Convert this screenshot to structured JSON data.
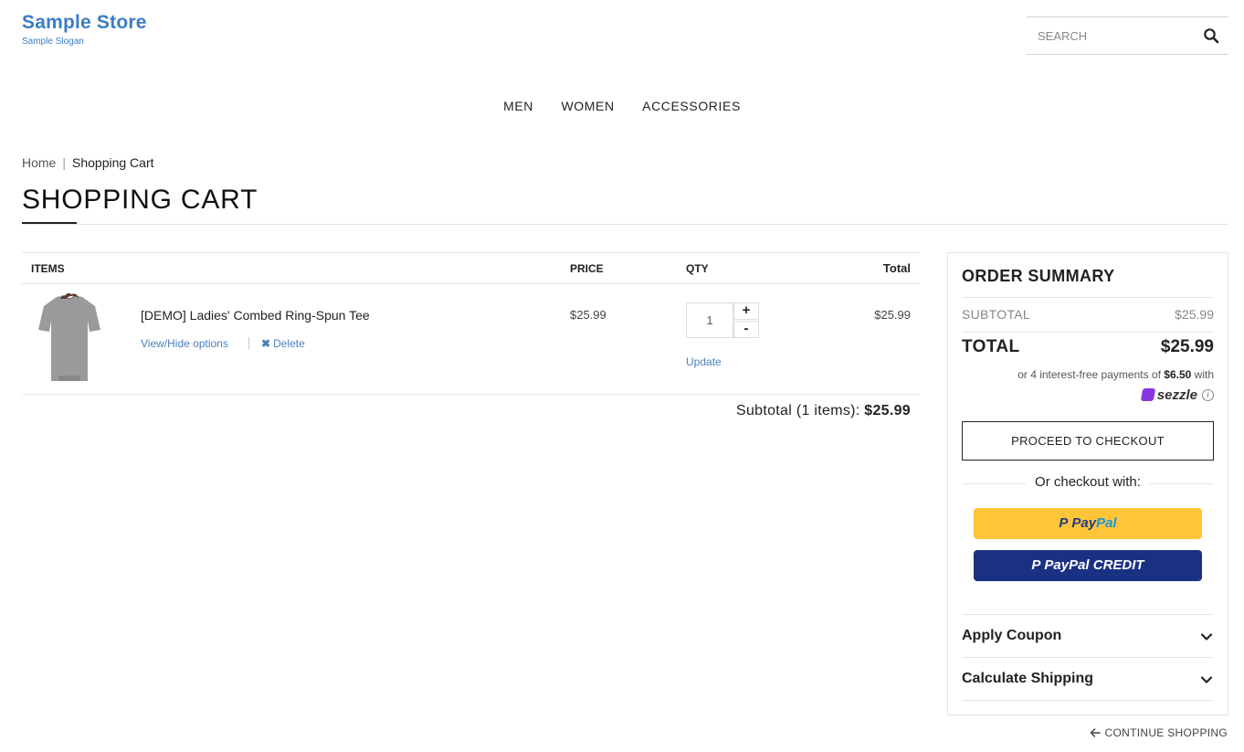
{
  "store": {
    "name": "Sample Store",
    "slogan": "Sample Slogan"
  },
  "search": {
    "placeholder": "SEARCH"
  },
  "nav": [
    "MEN",
    "WOMEN",
    "ACCESSORIES"
  ],
  "breadcrumb": {
    "home": "Home",
    "separator": "|",
    "current": "Shopping Cart"
  },
  "page_title": "SHOPPING CART",
  "cart": {
    "headers": {
      "items": "ITEMS",
      "price": "PRICE",
      "qty": "QTY",
      "total": "Total"
    },
    "items": [
      {
        "name": "[DEMO] Ladies' Combed Ring-Spun Tee",
        "options_link": "View/Hide options",
        "delete_link": "Delete",
        "price": "$25.99",
        "qty": "1",
        "plus": "+",
        "minus": "-",
        "update": "Update",
        "total": "$25.99"
      }
    ],
    "subtotal_label": "Subtotal (1 items):",
    "subtotal_value": "$25.99"
  },
  "summary": {
    "title": "ORDER SUMMARY",
    "subtotal_label": "SUBTOTAL",
    "subtotal_value": "$25.99",
    "total_label": "TOTAL",
    "total_value": "$25.99",
    "sezzle_prefix": "or 4 interest-free payments of",
    "sezzle_amount": "$6.50",
    "sezzle_suffix": "with",
    "sezzle_brand": "sezzle",
    "sezzle_info": "i",
    "checkout_label": "PROCEED TO CHECKOUT",
    "or_checkout": "Or checkout with:",
    "paypal_pay": "Pay",
    "paypal_pal": "Pal",
    "paypal_credit": "PayPal CREDIT",
    "apply_coupon": "Apply Coupon",
    "calculate_shipping": "Calculate Shipping"
  },
  "continue_shopping": "CONTINUE SHOPPING",
  "colors": {
    "accent": "#3b7dc4",
    "link": "#4a7fbf",
    "paypal_yellow": "#ffc439",
    "paypal_blue": "#1a3183",
    "sezzle_purple": "#8a36e0"
  }
}
